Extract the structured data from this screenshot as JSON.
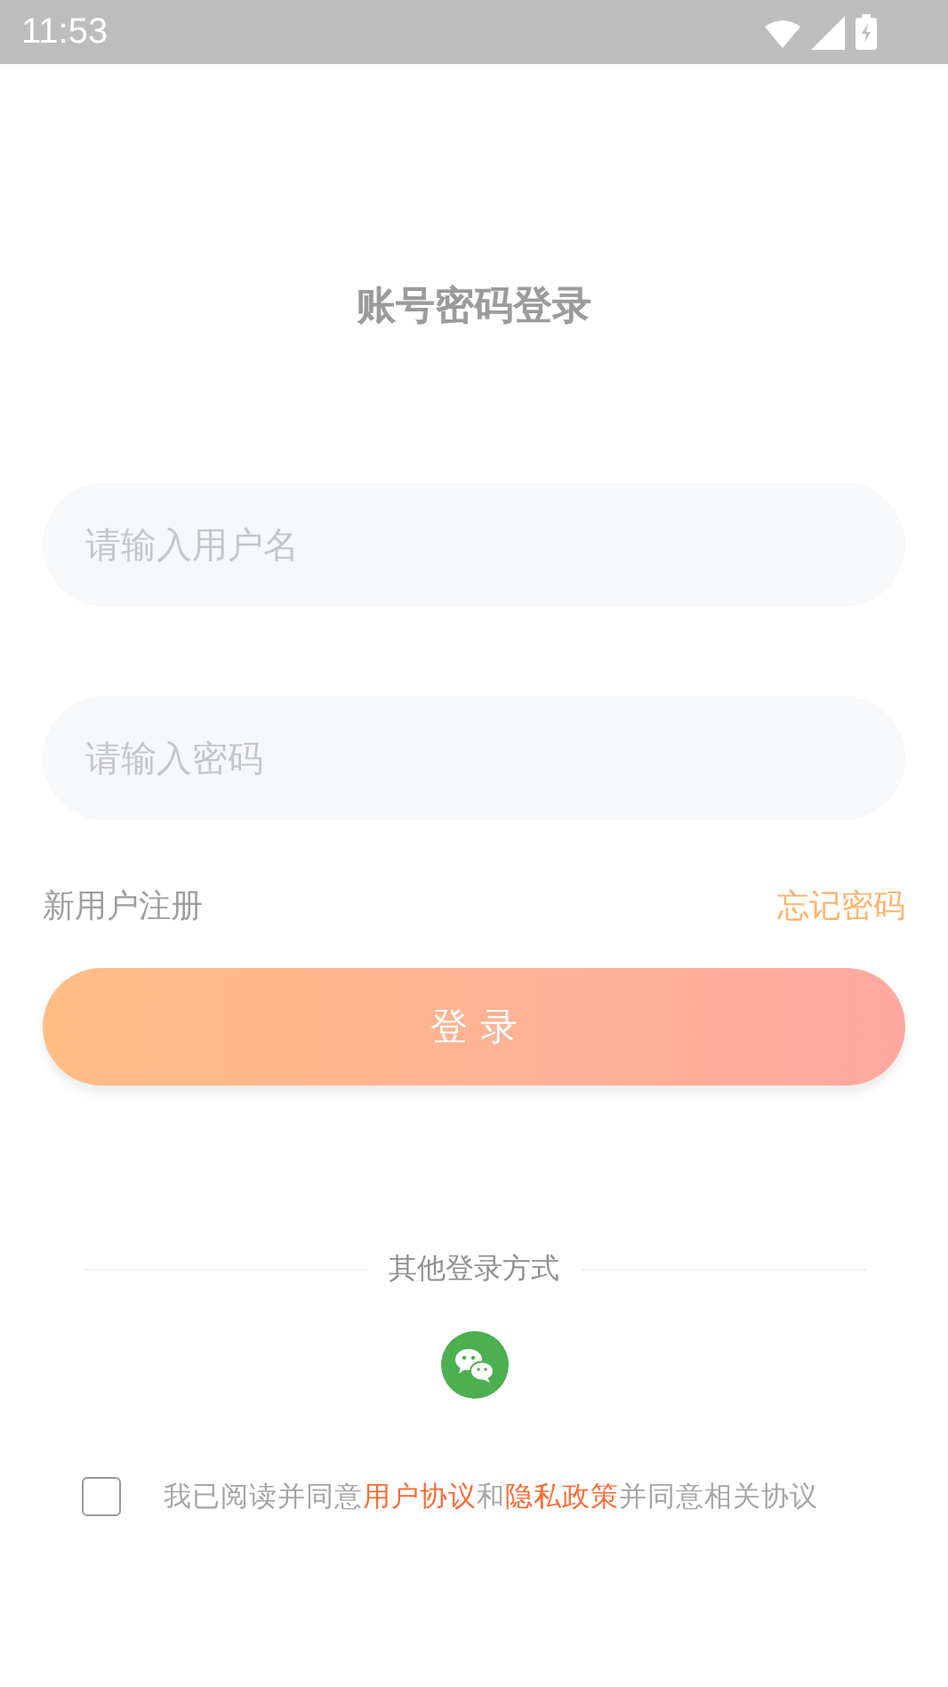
{
  "status_bar": {
    "time": "11:53"
  },
  "title": "账号密码登录",
  "username_field": {
    "placeholder": "请输入用户名"
  },
  "password_field": {
    "placeholder": "请输入密码"
  },
  "register_link": "新用户注册",
  "forgot_link": "忘记密码",
  "login_button": "登 录",
  "other_methods": "其他登录方式",
  "consent": {
    "checked": false,
    "parts": [
      {
        "kind": "plain",
        "text": "我已阅读并同意"
      },
      {
        "kind": "link",
        "text": "用户协议"
      },
      {
        "kind": "plain",
        "text": "和"
      },
      {
        "kind": "link",
        "text": "隐私政策"
      },
      {
        "kind": "plain",
        "text": "并同意相关协议"
      }
    ]
  }
}
